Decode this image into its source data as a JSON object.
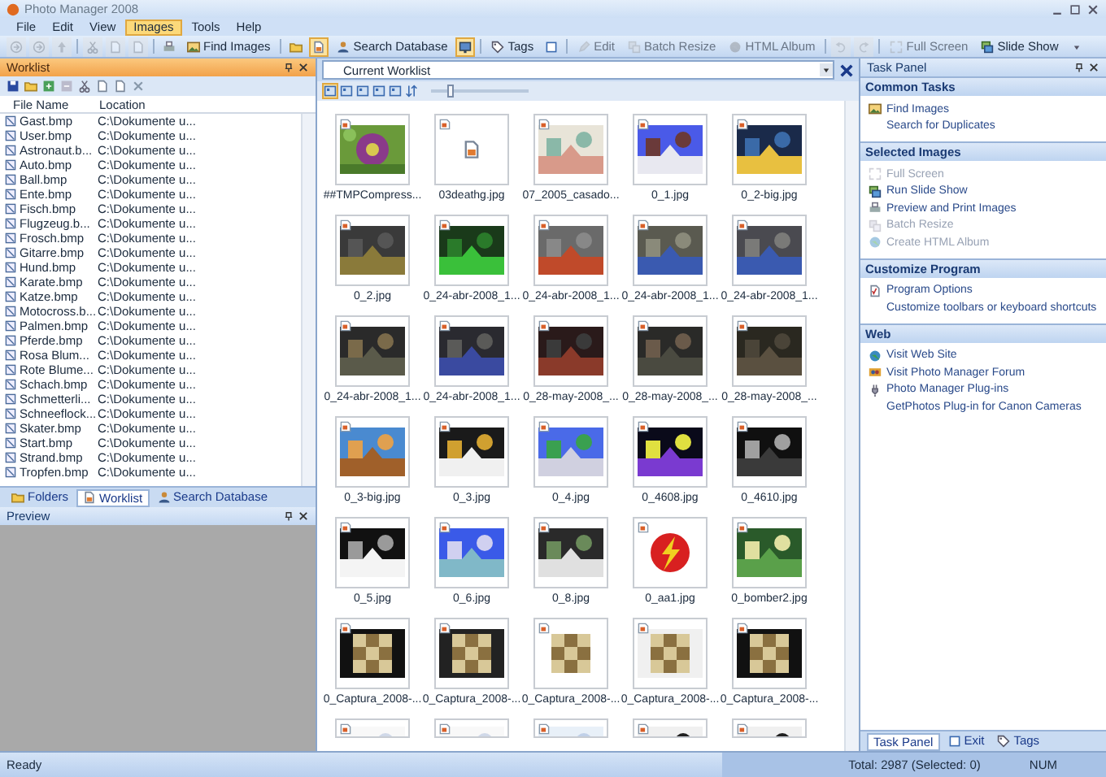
{
  "window": {
    "title": "Photo Manager 2008"
  },
  "menu": [
    {
      "label": "File",
      "selected": false
    },
    {
      "label": "Edit",
      "selected": false
    },
    {
      "label": "View",
      "selected": false
    },
    {
      "label": "Images",
      "selected": true
    },
    {
      "label": "Tools",
      "selected": false
    },
    {
      "label": "Help",
      "selected": false
    }
  ],
  "toolbar": [
    {
      "kind": "icon",
      "disabled": true,
      "on": false
    },
    {
      "kind": "icon",
      "disabled": true,
      "on": false
    },
    {
      "kind": "icon",
      "disabled": true,
      "on": false
    },
    {
      "kind": "separator"
    },
    {
      "kind": "icon",
      "disabled": true,
      "on": false
    },
    {
      "kind": "icon",
      "disabled": true,
      "on": false
    },
    {
      "kind": "icon",
      "disabled": true,
      "on": false
    },
    {
      "kind": "separator"
    },
    {
      "kind": "icon",
      "disabled": false,
      "on": false
    },
    {
      "kind": "button",
      "label": "Find Images",
      "disabled": false,
      "on": false
    },
    {
      "kind": "separator"
    },
    {
      "kind": "icon",
      "disabled": false,
      "on": false
    },
    {
      "kind": "icon",
      "disabled": false,
      "on": true
    },
    {
      "kind": "button",
      "label": "Search Database",
      "disabled": false,
      "on": false
    },
    {
      "kind": "icon",
      "disabled": false,
      "on": true
    },
    {
      "kind": "separator"
    },
    {
      "kind": "button",
      "label": "Tags",
      "disabled": false,
      "on": false
    },
    {
      "kind": "icon",
      "disabled": false,
      "on": false
    },
    {
      "kind": "separator"
    },
    {
      "kind": "button",
      "label": "Edit",
      "disabled": true,
      "on": false
    },
    {
      "kind": "button",
      "label": "Batch Resize",
      "disabled": true,
      "on": false
    },
    {
      "kind": "button",
      "label": "HTML Album",
      "disabled": true,
      "on": false
    },
    {
      "kind": "separator"
    },
    {
      "kind": "icon",
      "disabled": true,
      "on": false
    },
    {
      "kind": "icon",
      "disabled": true,
      "on": false
    },
    {
      "kind": "separator"
    },
    {
      "kind": "button",
      "label": "Full Screen",
      "disabled": true,
      "on": false
    },
    {
      "kind": "button",
      "label": "Slide Show",
      "disabled": false,
      "on": false
    },
    {
      "kind": "icon",
      "disabled": false,
      "on": false
    }
  ],
  "worklist": {
    "title": "Worklist",
    "columns": [
      "File Name",
      "Location"
    ],
    "rows": [
      {
        "name": "Gast.bmp",
        "location": "C:\\Dokumente u..."
      },
      {
        "name": "User.bmp",
        "location": "C:\\Dokumente u..."
      },
      {
        "name": "Astronaut.b...",
        "location": "C:\\Dokumente u..."
      },
      {
        "name": "Auto.bmp",
        "location": "C:\\Dokumente u..."
      },
      {
        "name": "Ball.bmp",
        "location": "C:\\Dokumente u..."
      },
      {
        "name": "Ente.bmp",
        "location": "C:\\Dokumente u..."
      },
      {
        "name": "Fisch.bmp",
        "location": "C:\\Dokumente u..."
      },
      {
        "name": "Flugzeug.b...",
        "location": "C:\\Dokumente u..."
      },
      {
        "name": "Frosch.bmp",
        "location": "C:\\Dokumente u..."
      },
      {
        "name": "Gitarre.bmp",
        "location": "C:\\Dokumente u..."
      },
      {
        "name": "Hund.bmp",
        "location": "C:\\Dokumente u..."
      },
      {
        "name": "Karate.bmp",
        "location": "C:\\Dokumente u..."
      },
      {
        "name": "Katze.bmp",
        "location": "C:\\Dokumente u..."
      },
      {
        "name": "Motocross.b...",
        "location": "C:\\Dokumente u..."
      },
      {
        "name": "Palmen.bmp",
        "location": "C:\\Dokumente u..."
      },
      {
        "name": "Pferde.bmp",
        "location": "C:\\Dokumente u..."
      },
      {
        "name": "Rosa Blum...",
        "location": "C:\\Dokumente u..."
      },
      {
        "name": "Rote Blume...",
        "location": "C:\\Dokumente u..."
      },
      {
        "name": "Schach.bmp",
        "location": "C:\\Dokumente u..."
      },
      {
        "name": "Schmetterli...",
        "location": "C:\\Dokumente u..."
      },
      {
        "name": "Schneeflock...",
        "location": "C:\\Dokumente u..."
      },
      {
        "name": "Skater.bmp",
        "location": "C:\\Dokumente u..."
      },
      {
        "name": "Start.bmp",
        "location": "C:\\Dokumente u..."
      },
      {
        "name": "Strand.bmp",
        "location": "C:\\Dokumente u..."
      },
      {
        "name": "Tropfen.bmp",
        "location": "C:\\Dokumente u..."
      }
    ]
  },
  "left_tabs": [
    {
      "label": "Folders",
      "selected": false
    },
    {
      "label": "Worklist",
      "selected": true
    },
    {
      "label": "Search Database",
      "selected": false
    }
  ],
  "preview": {
    "title": "Preview"
  },
  "viewer": {
    "source": "Current Worklist",
    "zoom": {
      "level": 0.2
    },
    "thumbnails": [
      {
        "kind": "picture",
        "name": "##TMPCompress..."
      },
      {
        "kind": "file",
        "name": "03deathg.jpg"
      },
      {
        "kind": "picture",
        "name": "07_2005_casado..."
      },
      {
        "kind": "picture",
        "name": "0_1.jpg"
      },
      {
        "kind": "picture",
        "name": "0_2-big.jpg"
      },
      {
        "kind": "picture",
        "name": "0_2.jpg"
      },
      {
        "kind": "picture",
        "name": "0_24-abr-2008_1..."
      },
      {
        "kind": "picture",
        "name": "0_24-abr-2008_1..."
      },
      {
        "kind": "picture",
        "name": "0_24-abr-2008_1..."
      },
      {
        "kind": "picture",
        "name": "0_24-abr-2008_1..."
      },
      {
        "kind": "picture",
        "name": "0_24-abr-2008_1..."
      },
      {
        "kind": "picture",
        "name": "0_24-abr-2008_1..."
      },
      {
        "kind": "picture",
        "name": "0_28-may-2008_..."
      },
      {
        "kind": "picture",
        "name": "0_28-may-2008_..."
      },
      {
        "kind": "picture",
        "name": "0_28-may-2008_..."
      },
      {
        "kind": "picture",
        "name": "0_3-big.jpg"
      },
      {
        "kind": "picture",
        "name": "0_3.jpg"
      },
      {
        "kind": "picture",
        "name": "0_4.jpg"
      },
      {
        "kind": "picture",
        "name": "0_4608.jpg"
      },
      {
        "kind": "picture",
        "name": "0_4610.jpg"
      },
      {
        "kind": "picture",
        "name": "0_5.jpg"
      },
      {
        "kind": "picture",
        "name": "0_6.jpg"
      },
      {
        "kind": "picture",
        "name": "0_8.jpg"
      },
      {
        "kind": "picture",
        "name": "0_aa1.jpg"
      },
      {
        "kind": "picture",
        "name": "0_bomber2.jpg"
      },
      {
        "kind": "picture",
        "name": "0_Captura_2008-..."
      },
      {
        "kind": "picture",
        "name": "0_Captura_2008-..."
      },
      {
        "kind": "picture",
        "name": "0_Captura_2008-..."
      },
      {
        "kind": "picture",
        "name": "0_Captura_2008-..."
      },
      {
        "kind": "picture",
        "name": "0_Captura_2008-..."
      },
      {
        "kind": "picture"
      },
      {
        "kind": "picture"
      },
      {
        "kind": "picture"
      },
      {
        "kind": "picture"
      },
      {
        "kind": "picture"
      }
    ]
  },
  "task_panel": {
    "title": "Task Panel",
    "sections": [
      {
        "title": "Common Tasks",
        "items": [
          {
            "label": "Find Images",
            "kind": "icon",
            "disabled": false
          },
          {
            "label": "Search for Duplicates",
            "kind": "plain",
            "disabled": false
          }
        ]
      },
      {
        "title": "Selected Images",
        "items": [
          {
            "label": "Full Screen",
            "kind": "icon",
            "disabled": true
          },
          {
            "label": "Run Slide Show",
            "kind": "icon",
            "disabled": false
          },
          {
            "label": "Preview and Print Images",
            "kind": "icon",
            "disabled": false
          },
          {
            "label": "Batch Resize",
            "kind": "icon",
            "disabled": true
          },
          {
            "label": "Create HTML Album",
            "kind": "icon",
            "disabled": true
          }
        ]
      },
      {
        "title": "Customize Program",
        "items": [
          {
            "label": "Program Options",
            "kind": "icon",
            "disabled": false
          },
          {
            "label": "Customize toolbars or keyboard shortcuts",
            "kind": "plain",
            "disabled": false
          }
        ]
      },
      {
        "title": "Web",
        "items": [
          {
            "label": "Visit Web Site",
            "kind": "icon",
            "disabled": false
          },
          {
            "label": "Visit Photo Manager Forum",
            "kind": "icon",
            "disabled": false
          },
          {
            "label": "Photo Manager Plug-ins",
            "kind": "icon",
            "disabled": false
          },
          {
            "label": "GetPhotos Plug-in for Canon Cameras",
            "kind": "plain",
            "disabled": false
          }
        ]
      }
    ]
  },
  "right_tabs": [
    {
      "label": "Task Panel",
      "selected": true
    },
    {
      "label": "Exit",
      "selected": false
    },
    {
      "label": "Tags",
      "selected": false
    }
  ],
  "status_bar": {
    "message": "Ready",
    "total": "Total: 2987 (Selected: 0)",
    "mode": "NUM"
  }
}
